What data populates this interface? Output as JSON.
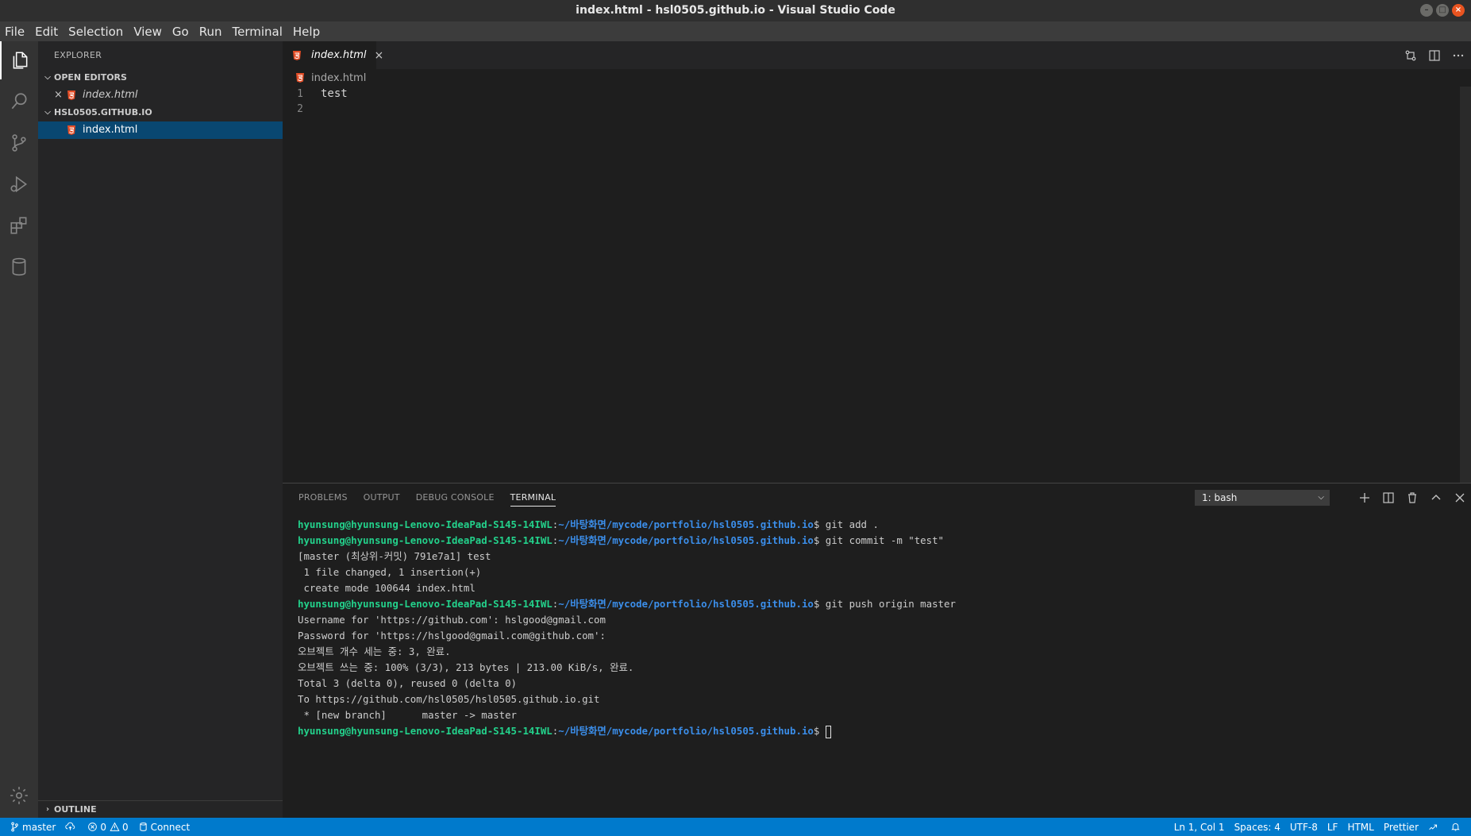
{
  "window": {
    "title": "index.html - hsl0505.github.io - Visual Studio Code"
  },
  "menu": [
    "File",
    "Edit",
    "Selection",
    "View",
    "Go",
    "Run",
    "Terminal",
    "Help"
  ],
  "sidebar": {
    "title": "EXPLORER",
    "open_editors_label": "OPEN EDITORS",
    "open_editors": [
      {
        "name": "index.html"
      }
    ],
    "folder_label": "HSL0505.GITHUB.IO",
    "files": [
      {
        "name": "index.html"
      }
    ],
    "outline_label": "OUTLINE"
  },
  "editor": {
    "tab_label": "index.html",
    "breadcrumb": "index.html",
    "lines": [
      {
        "num": "1",
        "text": "test"
      },
      {
        "num": "2",
        "text": ""
      }
    ]
  },
  "panel": {
    "tabs": [
      "PROBLEMS",
      "OUTPUT",
      "DEBUG CONSOLE",
      "TERMINAL"
    ],
    "active_tab": "TERMINAL",
    "terminal_select": "1: bash"
  },
  "terminal": {
    "prompt_user": "hyunsung@hyunsung-Lenovo-IdeaPad-S145-14IWL",
    "prompt_path": "~/바탕화면/mycode/portfolio/hsl0505.github.io",
    "lines": [
      {
        "type": "prompt",
        "cmd": " git add ."
      },
      {
        "type": "prompt",
        "cmd": " git commit -m \"test\""
      },
      {
        "type": "out",
        "text": "[master (최상위-커밋) 791e7a1] test"
      },
      {
        "type": "out",
        "text": " 1 file changed, 1 insertion(+)"
      },
      {
        "type": "out",
        "text": " create mode 100644 index.html"
      },
      {
        "type": "prompt",
        "cmd": " git push origin master"
      },
      {
        "type": "out",
        "text": "Username for 'https://github.com': hslgood@gmail.com"
      },
      {
        "type": "out",
        "text": "Password for 'https://hslgood@gmail.com@github.com':"
      },
      {
        "type": "out",
        "text": "오브젝트 개수 세는 중: 3, 완료."
      },
      {
        "type": "out",
        "text": "오브젝트 쓰는 중: 100% (3/3), 213 bytes | 213.00 KiB/s, 완료."
      },
      {
        "type": "out",
        "text": "Total 3 (delta 0), reused 0 (delta 0)"
      },
      {
        "type": "out",
        "text": "To https://github.com/hsl0505/hsl0505.github.io.git"
      },
      {
        "type": "out",
        "text": " * [new branch]      master -> master"
      },
      {
        "type": "prompt",
        "cmd": " ",
        "cursor": true
      }
    ]
  },
  "status": {
    "branch": "master",
    "errors": "0",
    "warnings": "0",
    "connect": "Connect",
    "position": "Ln 1, Col 1",
    "spaces": "Spaces: 4",
    "encoding": "UTF-8",
    "eol": "LF",
    "language": "HTML",
    "formatter": "Prettier"
  },
  "icons": {
    "activity": [
      "files-icon",
      "search-icon",
      "source-control-icon",
      "run-debug-icon",
      "extensions-icon",
      "database-icon",
      "settings-gear-icon"
    ],
    "html_file_color": "#e44d26"
  },
  "colors": {
    "statusbar": "#007acc",
    "terminal_user": "#23d18b",
    "terminal_path": "#3b8eea",
    "selection": "#094771"
  }
}
